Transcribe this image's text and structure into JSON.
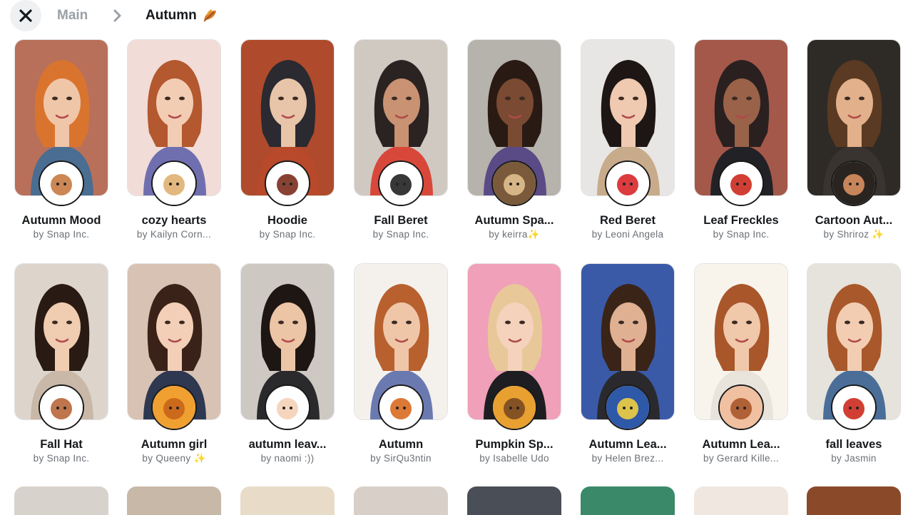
{
  "header": {
    "close_icon": "close-icon",
    "breadcrumb": {
      "main": "Main",
      "current": "Autumn"
    }
  },
  "lenses": [
    {
      "title": "Autumn Mood",
      "author": "by Snap Inc.",
      "bg": "#b8705a",
      "skin": "#f0c6a8",
      "hair": "#d9742f",
      "shirt": "#4a6d92",
      "icon_bg": "#ffffff",
      "icon_fg": "#c77a42"
    },
    {
      "title": "cozy hearts",
      "author": "by Kailyn Corn...",
      "bg": "#f2dcd8",
      "skin": "#f2cdb4",
      "hair": "#b3582f",
      "shirt": "#6f6fb0",
      "icon_bg": "#ffffff",
      "icon_fg": "#e0b070"
    },
    {
      "title": "Hoodie",
      "author": "by Snap Inc.",
      "bg": "#b04a2c",
      "skin": "#e8c4a8",
      "hair": "#2a2a30",
      "shirt": "#b8492a",
      "icon_bg": "#ffffff",
      "icon_fg": "#7a2e1e"
    },
    {
      "title": "Fall Beret",
      "author": "by Snap Inc.",
      "bg": "#cfc9c2",
      "skin": "#c99272",
      "hair": "#2b2222",
      "shirt": "#d8483a",
      "icon_bg": "#ffffff",
      "icon_fg": "#222222"
    },
    {
      "title": "Autumn Spa...",
      "author": "by keirra✨",
      "bg": "#b6b2ac",
      "skin": "#7a4a32",
      "hair": "#2a1a14",
      "shirt": "#5a4a86",
      "icon_bg": "#7a5a3a",
      "icon_fg": "#e0c090"
    },
    {
      "title": "Red Beret",
      "author": "by Leoni Angela",
      "bg": "#e8e6e4",
      "skin": "#efc9b0",
      "hair": "#1e1614",
      "shirt": "#c8ab8a",
      "icon_bg": "#ffffff",
      "icon_fg": "#d8262a"
    },
    {
      "title": "Leaf Freckles",
      "author": "by Snap Inc.",
      "bg": "#a4584a",
      "skin": "#9a6248",
      "hair": "#2a2020",
      "shirt": "#222226",
      "icon_bg": "#ffffff",
      "icon_fg": "#cc2a1e"
    },
    {
      "title": "Cartoon Aut...",
      "author": "by Shriroz ✨",
      "bg": "#2e2a26",
      "skin": "#e2b08a",
      "hair": "#5a3a22",
      "shirt": "#3a3430",
      "icon_bg": "#2a2420",
      "icon_fg": "#d89060"
    },
    {
      "title": "Fall Hat",
      "author": "by Snap Inc.",
      "bg": "#ddd5cc",
      "skin": "#f0ccb0",
      "hair": "#2a1a14",
      "shirt": "#c9b8a8",
      "icon_bg": "#ffffff",
      "icon_fg": "#b8663a"
    },
    {
      "title": "Autumn girl",
      "author": "by Queeny ✨",
      "bg": "#d8c2b4",
      "skin": "#f2cfb6",
      "hair": "#3a2218",
      "shirt": "#2e3850",
      "icon_bg": "#f0a030",
      "icon_fg": "#c8641a"
    },
    {
      "title": "autumn leav...",
      "author": "by naomi :))",
      "bg": "#cdc8c2",
      "skin": "#ecc4a6",
      "hair": "#1e1612",
      "shirt": "#2a2a2c",
      "icon_bg": "#ffffff",
      "icon_fg": "#f5d0b8"
    },
    {
      "title": "Autumn",
      "author": "by SirQu3ntin",
      "bg": "#f4f0ec",
      "skin": "#efc6a8",
      "hair": "#b8602e",
      "shirt": "#6a7ab0",
      "icon_bg": "#ffffff",
      "icon_fg": "#d86a20"
    },
    {
      "title": "Pumpkin Sp...",
      "author": "by Isabelle Udo",
      "bg": "#f0a0b8",
      "skin": "#f4d2bc",
      "hair": "#e8c898",
      "shirt": "#1e1e22",
      "icon_bg": "#e8a030",
      "icon_fg": "#7a4a22"
    },
    {
      "title": "Autumn Lea...",
      "author": "by Helen Brez...",
      "bg": "#3a5aa8",
      "skin": "#e0b092",
      "hair": "#3a2418",
      "shirt": "#2a2a2e",
      "icon_bg": "#2e58a8",
      "icon_fg": "#f0d040"
    },
    {
      "title": "Autumn Lea...",
      "author": "by Gerard Kille...",
      "bg": "#f8f4ec",
      "skin": "#f0c8aa",
      "hair": "#a8562a",
      "shirt": "#e8e4dc",
      "icon_bg": "#f0c0a0",
      "icon_fg": "#a8562a"
    },
    {
      "title": "fall leaves",
      "author": "by Jasmin",
      "bg": "#e6e2dc",
      "skin": "#f2cdb2",
      "hair": "#a8582a",
      "shirt": "#4a6e98",
      "icon_bg": "#ffffff",
      "icon_fg": "#cc2a1e"
    }
  ],
  "peek_colors": [
    "#d8d2cc",
    "#c8b8a8",
    "#e8dcc8",
    "#d8d0c8",
    "#4a4e56",
    "#3a8a6a",
    "#f0e8e0",
    "#8a4a2a"
  ]
}
